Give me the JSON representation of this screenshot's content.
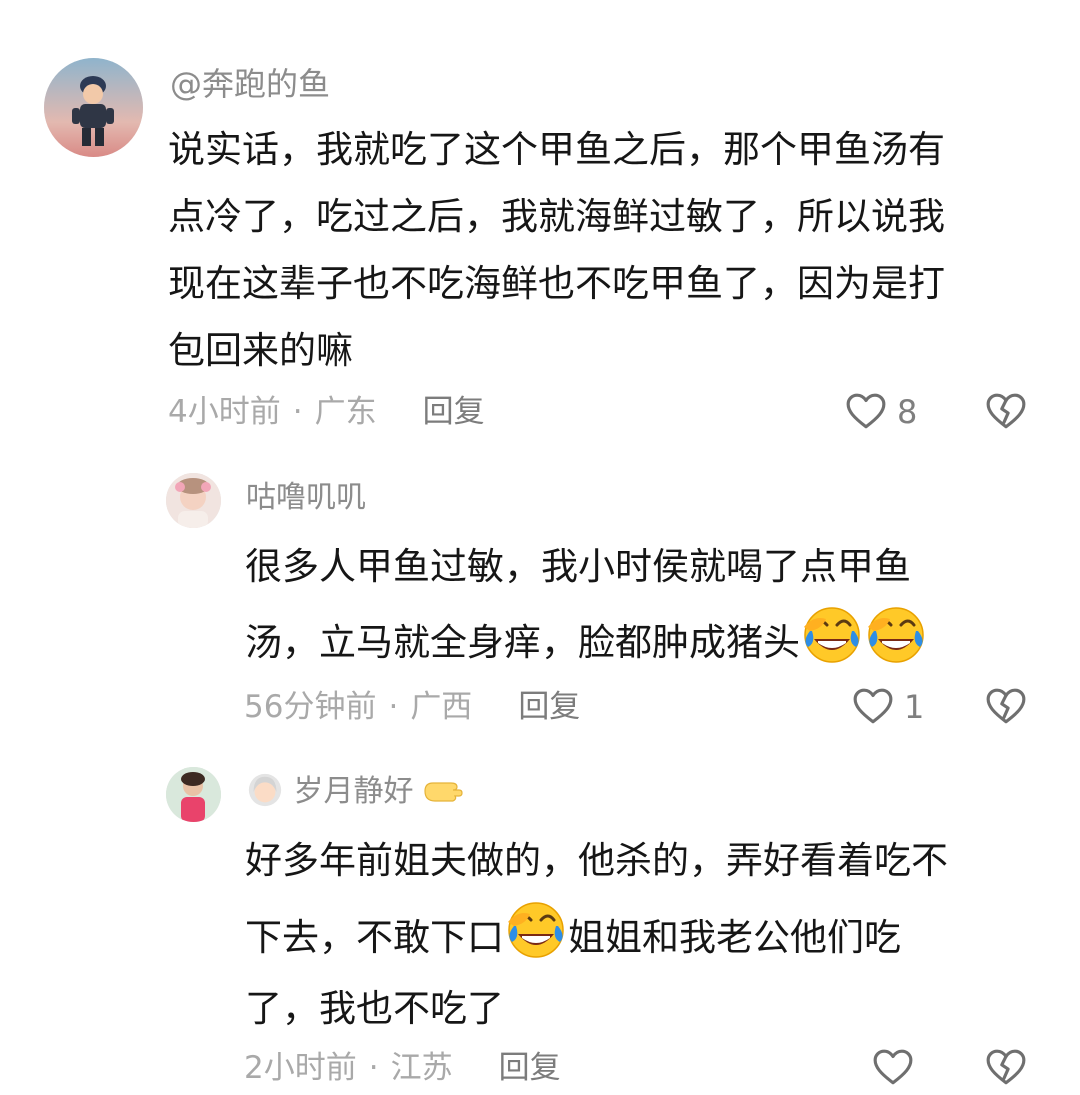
{
  "comments": [
    {
      "username": "@奔跑的鱼",
      "text_lines": [
        "说实话，我就吃了这个甲鱼之后，那个甲鱼汤有",
        "点冷了，吃过之后，我就海鲜过敏了，所以说我",
        "现在这辈子也不吃海鲜也不吃甲鱼了，因为是打",
        "包回来的嘛"
      ],
      "time": "4小时前",
      "location": "广东",
      "reply_label": "回复",
      "likes": "8",
      "icons": [
        "heart-icon",
        "broken-heart-icon"
      ]
    },
    {
      "username": "咕噜叽叽",
      "text_lines": [
        "很多人甲鱼过敏，我小时侯就喝了点甲鱼",
        "汤，立马就全身痒，脸都肿成猪头"
      ],
      "time": "56分钟前",
      "location": "广西",
      "reply_label": "回复",
      "likes": "1",
      "icons": [
        "laugh-cry-emoji",
        "heart-icon",
        "broken-heart-icon"
      ]
    },
    {
      "username": "岁月静好",
      "text_lines": [
        "好多年前姐夫做的，他杀的，弄好看着吃不",
        "下去，不敢下口",
        "姐姐和我老公他们吃",
        "了，我也不吃了"
      ],
      "time": "2小时前",
      "location": "江苏",
      "reply_label": "回复",
      "icons": [
        "woman-emoji",
        "hand-emoji",
        "laugh-cry-emoji",
        "heart-icon",
        "broken-heart-icon"
      ]
    }
  ],
  "separator": "·"
}
